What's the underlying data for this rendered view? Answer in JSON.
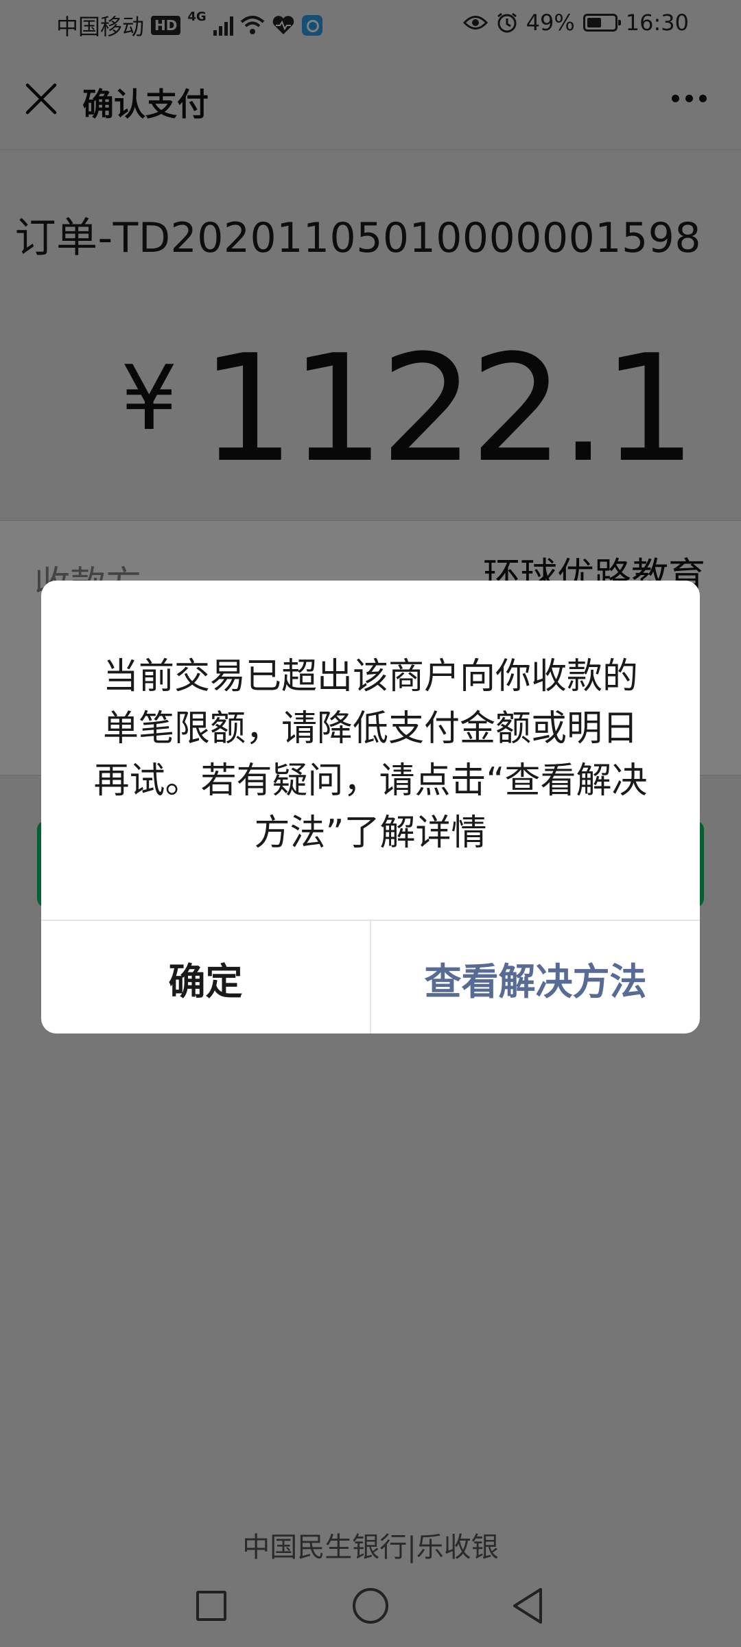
{
  "status_bar": {
    "carrier": "中国移动",
    "hd_badge": "HD",
    "network": "4G",
    "battery_percent": "49%",
    "time": "16:30"
  },
  "navbar": {
    "title": "确认支付"
  },
  "payment": {
    "order_number": "订单-TD20201105010000001598",
    "currency_symbol": "¥",
    "amount": "1122.1",
    "payee_label": "收款方",
    "payee_value": "环球优路教育"
  },
  "dialog": {
    "message": "当前交易已超出该商户向你收款的单笔限额，请降低支付金额或明日再试。若有疑问，请点击“查看解决方法”了解详情",
    "confirm_label": "确定",
    "solution_label": "查看解决方法"
  },
  "footer": {
    "provider": "中国民生银行|乐收银"
  },
  "colors": {
    "accent_green": "#07c160",
    "link_blue": "#576b95",
    "background": "#ededed"
  }
}
